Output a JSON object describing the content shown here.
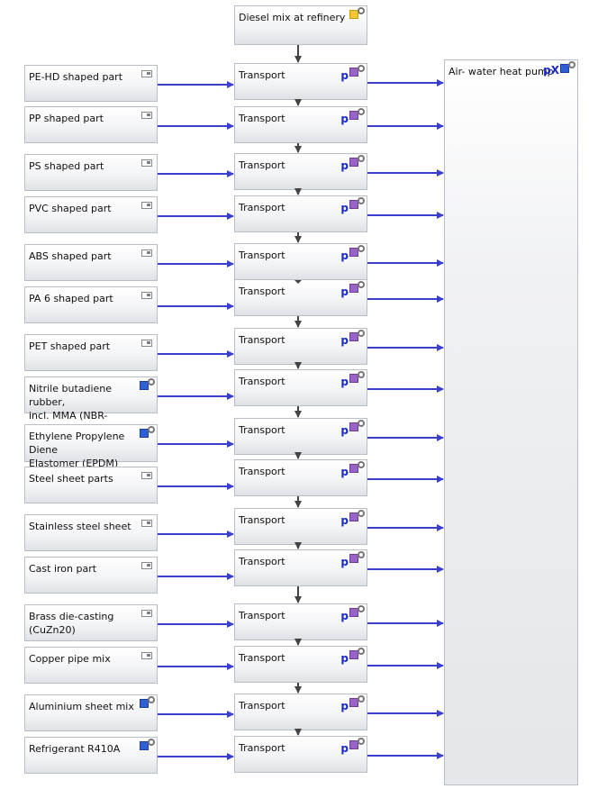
{
  "diesel": {
    "label": "Diesel mix at refinery"
  },
  "heat_pump": {
    "label": "Air- water heat pump"
  },
  "transport_label": "Transport",
  "rows": [
    {
      "label": "PE-HD shaped part",
      "icon": "plan"
    },
    {
      "label": "PP shaped part",
      "icon": "plan"
    },
    {
      "label": "PS shaped part",
      "icon": "plan"
    },
    {
      "label": "PVC shaped part",
      "icon": "plan"
    },
    {
      "label": "ABS shaped part",
      "icon": "plan"
    },
    {
      "label": "PA 6 shaped part",
      "icon": "plan"
    },
    {
      "label": "PET shaped part",
      "icon": "plan"
    },
    {
      "label": "Nitrile butadiene rubber,\nincl. MMA (NBR-speciality) PE",
      "icon": "process"
    },
    {
      "label": "Ethylene Propylene Diene\nElastomer (EPDM)",
      "icon": "process"
    },
    {
      "label": "Steel sheet parts",
      "icon": "plan"
    },
    {
      "label": "Stainless steel sheet",
      "icon": "plan"
    },
    {
      "label": "Cast iron part",
      "icon": "plan"
    },
    {
      "label": "Brass die-casting\n(CuZn20)",
      "icon": "plan"
    },
    {
      "label": "Copper pipe mix",
      "icon": "plan"
    },
    {
      "label": "Aluminium sheet mix",
      "icon": "process"
    },
    {
      "label": "Refrigerant R410A",
      "icon": "process"
    }
  ],
  "transport_params_marker": "p",
  "heat_pump_marker": "pX",
  "colors": {
    "flow_arrow": "#3a3fcf",
    "connector": "#444444"
  }
}
